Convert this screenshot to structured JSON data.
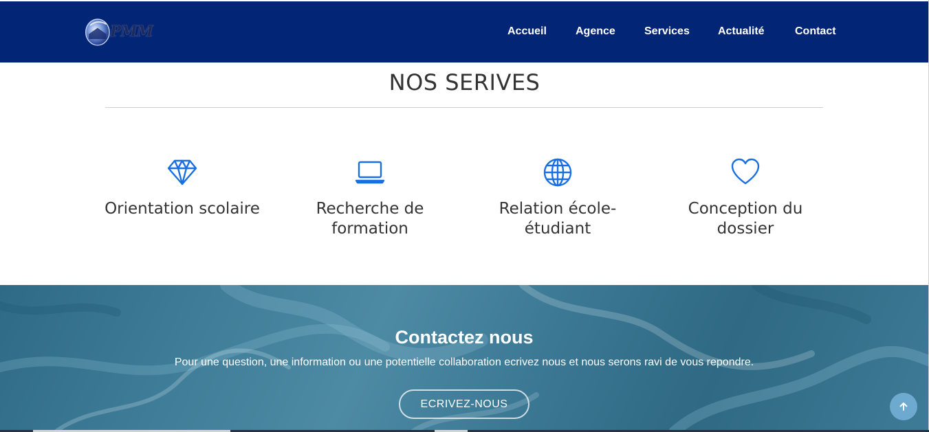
{
  "header": {
    "logo_text": "PMM",
    "nav": [
      "Accueil",
      "Agence",
      "Services",
      "Actualité",
      "Contact"
    ]
  },
  "services_section": {
    "title": "NOS SERIVES",
    "items": [
      {
        "icon": "diamond-icon",
        "label_lines": [
          "Orientation scolaire"
        ]
      },
      {
        "icon": "laptop-icon",
        "label_lines": [
          "Recherche de",
          "formation"
        ]
      },
      {
        "icon": "globe-icon",
        "label_lines": [
          "Relation école-",
          "étudiant"
        ]
      },
      {
        "icon": "heart-icon",
        "label_lines": [
          "Conception du",
          "dossier"
        ]
      }
    ]
  },
  "contact_section": {
    "title": "Contactez nous",
    "text": "Pour une question, une information ou une potentielle collaboration ecrivez nous et nous serons ravi de vous repondre.",
    "button_label": "ECRIVEZ-NOUS"
  },
  "colors": {
    "navbar": "#032575",
    "accent_icon": "#1a6fe0",
    "contact_bg": "#3e7b97",
    "back_to_top": "#6ea9cf"
  },
  "icons": {
    "back_to_top": "arrow-up-icon"
  }
}
